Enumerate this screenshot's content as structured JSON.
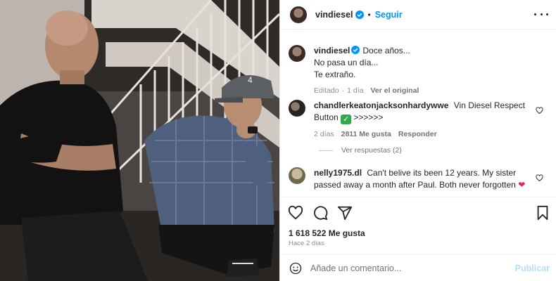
{
  "header": {
    "username": "vindiesel",
    "dot": "•",
    "follow_label": "Seguir"
  },
  "caption": {
    "username": "vindiesel",
    "line1": "Doce años...",
    "line2": "No pasa un día...",
    "line3": "Te extraño.",
    "edited": "Editado",
    "sep": "·",
    "time": "1 día",
    "see_original": "Ver el original"
  },
  "comments": [
    {
      "username": "chandlerkeatonjacksonhardywwe",
      "text_before": "Vin Diesel Respect Button",
      "text_after": ">>>>>>",
      "time": "2 días",
      "likes": "2811 Me gusta",
      "reply": "Responder",
      "view_replies": "Ver respuestas (2)"
    },
    {
      "username": "nelly1975.dl",
      "text": "Can't belive its been 12 years. My sister passed away a month after Paul. Both never forgotten"
    }
  ],
  "post": {
    "likes": "1 618 522 Me gusta",
    "ago": "Hace 2 días"
  },
  "composer": {
    "placeholder": "Añade un comentario...",
    "publish_label": "Publicar"
  },
  "icons": {
    "like": "heart-icon",
    "comment": "comment-icon",
    "share": "share-icon",
    "save": "bookmark-icon",
    "emoji": "emoji-icon",
    "more": "more-options-icon",
    "verified": "verified-badge-icon"
  },
  "colors": {
    "accent": "#0095f6",
    "publish_disabled": "#b2dffc",
    "verified": "#0095f6",
    "muted": "#8e8e8e"
  }
}
